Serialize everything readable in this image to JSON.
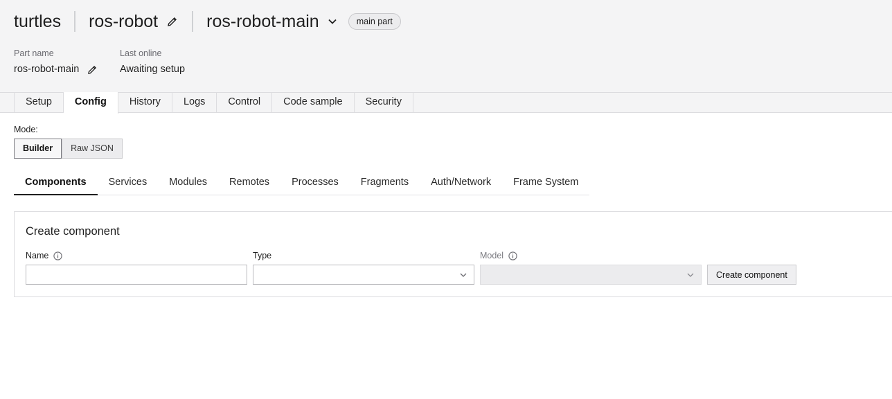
{
  "header": {
    "org": "turtles",
    "robot": "ros-robot",
    "part": "ros-robot-main",
    "badge": "main part",
    "part_name_label": "Part name",
    "part_name_value": "ros-robot-main",
    "last_online_label": "Last online",
    "last_online_value": "Awaiting setup"
  },
  "tabs": [
    {
      "label": "Setup"
    },
    {
      "label": "Config",
      "active": true
    },
    {
      "label": "History"
    },
    {
      "label": "Logs"
    },
    {
      "label": "Control"
    },
    {
      "label": "Code sample"
    },
    {
      "label": "Security"
    }
  ],
  "mode": {
    "label": "Mode:",
    "options": [
      {
        "label": "Builder",
        "active": true
      },
      {
        "label": "Raw JSON"
      }
    ]
  },
  "subtabs": [
    {
      "label": "Components",
      "active": true
    },
    {
      "label": "Services"
    },
    {
      "label": "Modules"
    },
    {
      "label": "Remotes"
    },
    {
      "label": "Processes"
    },
    {
      "label": "Fragments"
    },
    {
      "label": "Auth/Network"
    },
    {
      "label": "Frame System"
    }
  ],
  "create_component": {
    "title": "Create component",
    "name_label": "Name",
    "name_value": "",
    "type_label": "Type",
    "type_value": "",
    "model_label": "Model",
    "model_value": "",
    "button_label": "Create component"
  },
  "icons": {
    "edit": "pencil-icon",
    "part_dropdown": "chevron-down-icon",
    "info": "info-icon",
    "select_chevron": "chevron-down-icon"
  },
  "colors": {
    "header_bg": "#f4f4f5",
    "active_tab_bg": "#ffffff",
    "border": "#dcdcdf"
  }
}
